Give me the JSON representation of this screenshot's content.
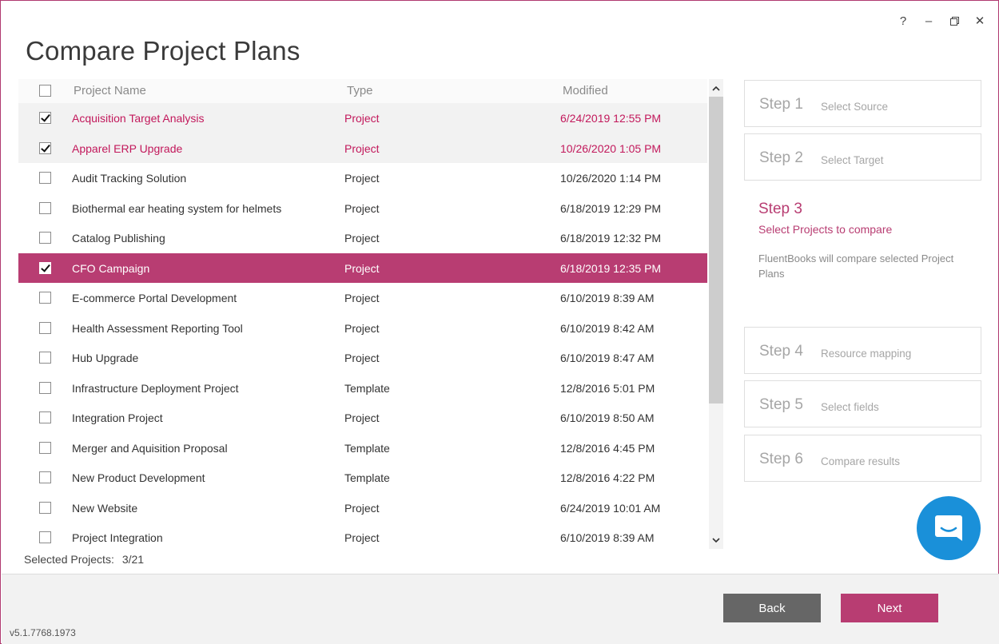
{
  "window": {
    "title": "Compare Project Plans",
    "controls": {
      "help": "?",
      "minimize": "–",
      "close": "✕"
    }
  },
  "table": {
    "headers": {
      "name": "Project Name",
      "type": "Type",
      "modified": "Modified"
    },
    "rows": [
      {
        "name": "Acquisition Target Analysis",
        "type": "Project",
        "modified": "6/24/2019 12:55 PM",
        "checked": true,
        "state": "selected"
      },
      {
        "name": "Apparel ERP Upgrade",
        "type": "Project",
        "modified": "10/26/2020 1:05 PM",
        "checked": true,
        "state": "selected"
      },
      {
        "name": "Audit Tracking Solution",
        "type": "Project",
        "modified": "10/26/2020 1:14 PM",
        "checked": false,
        "state": "normal"
      },
      {
        "name": "Biothermal ear heating system for helmets",
        "type": "Project",
        "modified": "6/18/2019 12:29 PM",
        "checked": false,
        "state": "normal"
      },
      {
        "name": "Catalog Publishing",
        "type": "Project",
        "modified": "6/18/2019 12:32 PM",
        "checked": false,
        "state": "normal"
      },
      {
        "name": "CFO Campaign",
        "type": "Project",
        "modified": "6/18/2019 12:35 PM",
        "checked": true,
        "state": "active"
      },
      {
        "name": "E-commerce Portal Development",
        "type": "Project",
        "modified": "6/10/2019 8:39 AM",
        "checked": false,
        "state": "normal"
      },
      {
        "name": "Health Assessment Reporting Tool",
        "type": "Project",
        "modified": "6/10/2019 8:42 AM",
        "checked": false,
        "state": "normal"
      },
      {
        "name": "Hub Upgrade",
        "type": "Project",
        "modified": "6/10/2019 8:47 AM",
        "checked": false,
        "state": "normal"
      },
      {
        "name": "Infrastructure Deployment Project",
        "type": "Template",
        "modified": "12/8/2016 5:01 PM",
        "checked": false,
        "state": "normal"
      },
      {
        "name": "Integration Project",
        "type": "Project",
        "modified": "6/10/2019 8:50 AM",
        "checked": false,
        "state": "normal"
      },
      {
        "name": "Merger and Aquisition Proposal",
        "type": "Template",
        "modified": "12/8/2016 4:45 PM",
        "checked": false,
        "state": "normal"
      },
      {
        "name": "New Product Development",
        "type": "Template",
        "modified": "12/8/2016 4:22 PM",
        "checked": false,
        "state": "normal"
      },
      {
        "name": "New Website",
        "type": "Project",
        "modified": "6/24/2019 10:01 AM",
        "checked": false,
        "state": "normal"
      },
      {
        "name": "Project Integration",
        "type": "Project",
        "modified": "6/10/2019 8:39 AM",
        "checked": false,
        "state": "normal"
      }
    ]
  },
  "selection": {
    "label": "Selected Projects:",
    "value": "3/21"
  },
  "steps": [
    {
      "num": "Step 1",
      "label": "Select Source"
    },
    {
      "num": "Step 2",
      "label": "Select Target"
    },
    {
      "num": "Step 3",
      "label": "Select Projects to compare",
      "desc": "FluentBooks will compare selected Project Plans"
    },
    {
      "num": "Step 4",
      "label": "Resource mapping"
    },
    {
      "num": "Step 5",
      "label": "Select fields"
    },
    {
      "num": "Step 6",
      "label": "Compare results"
    }
  ],
  "footer": {
    "back": "Back",
    "next": "Next",
    "version": "v5.1.7768.1973"
  },
  "colors": {
    "accent": "#b83d72",
    "chat": "#1a90d9",
    "back_button": "#666666"
  },
  "icons": {
    "chat": "chat-bubble-icon",
    "restore": "restore-window-icon"
  }
}
